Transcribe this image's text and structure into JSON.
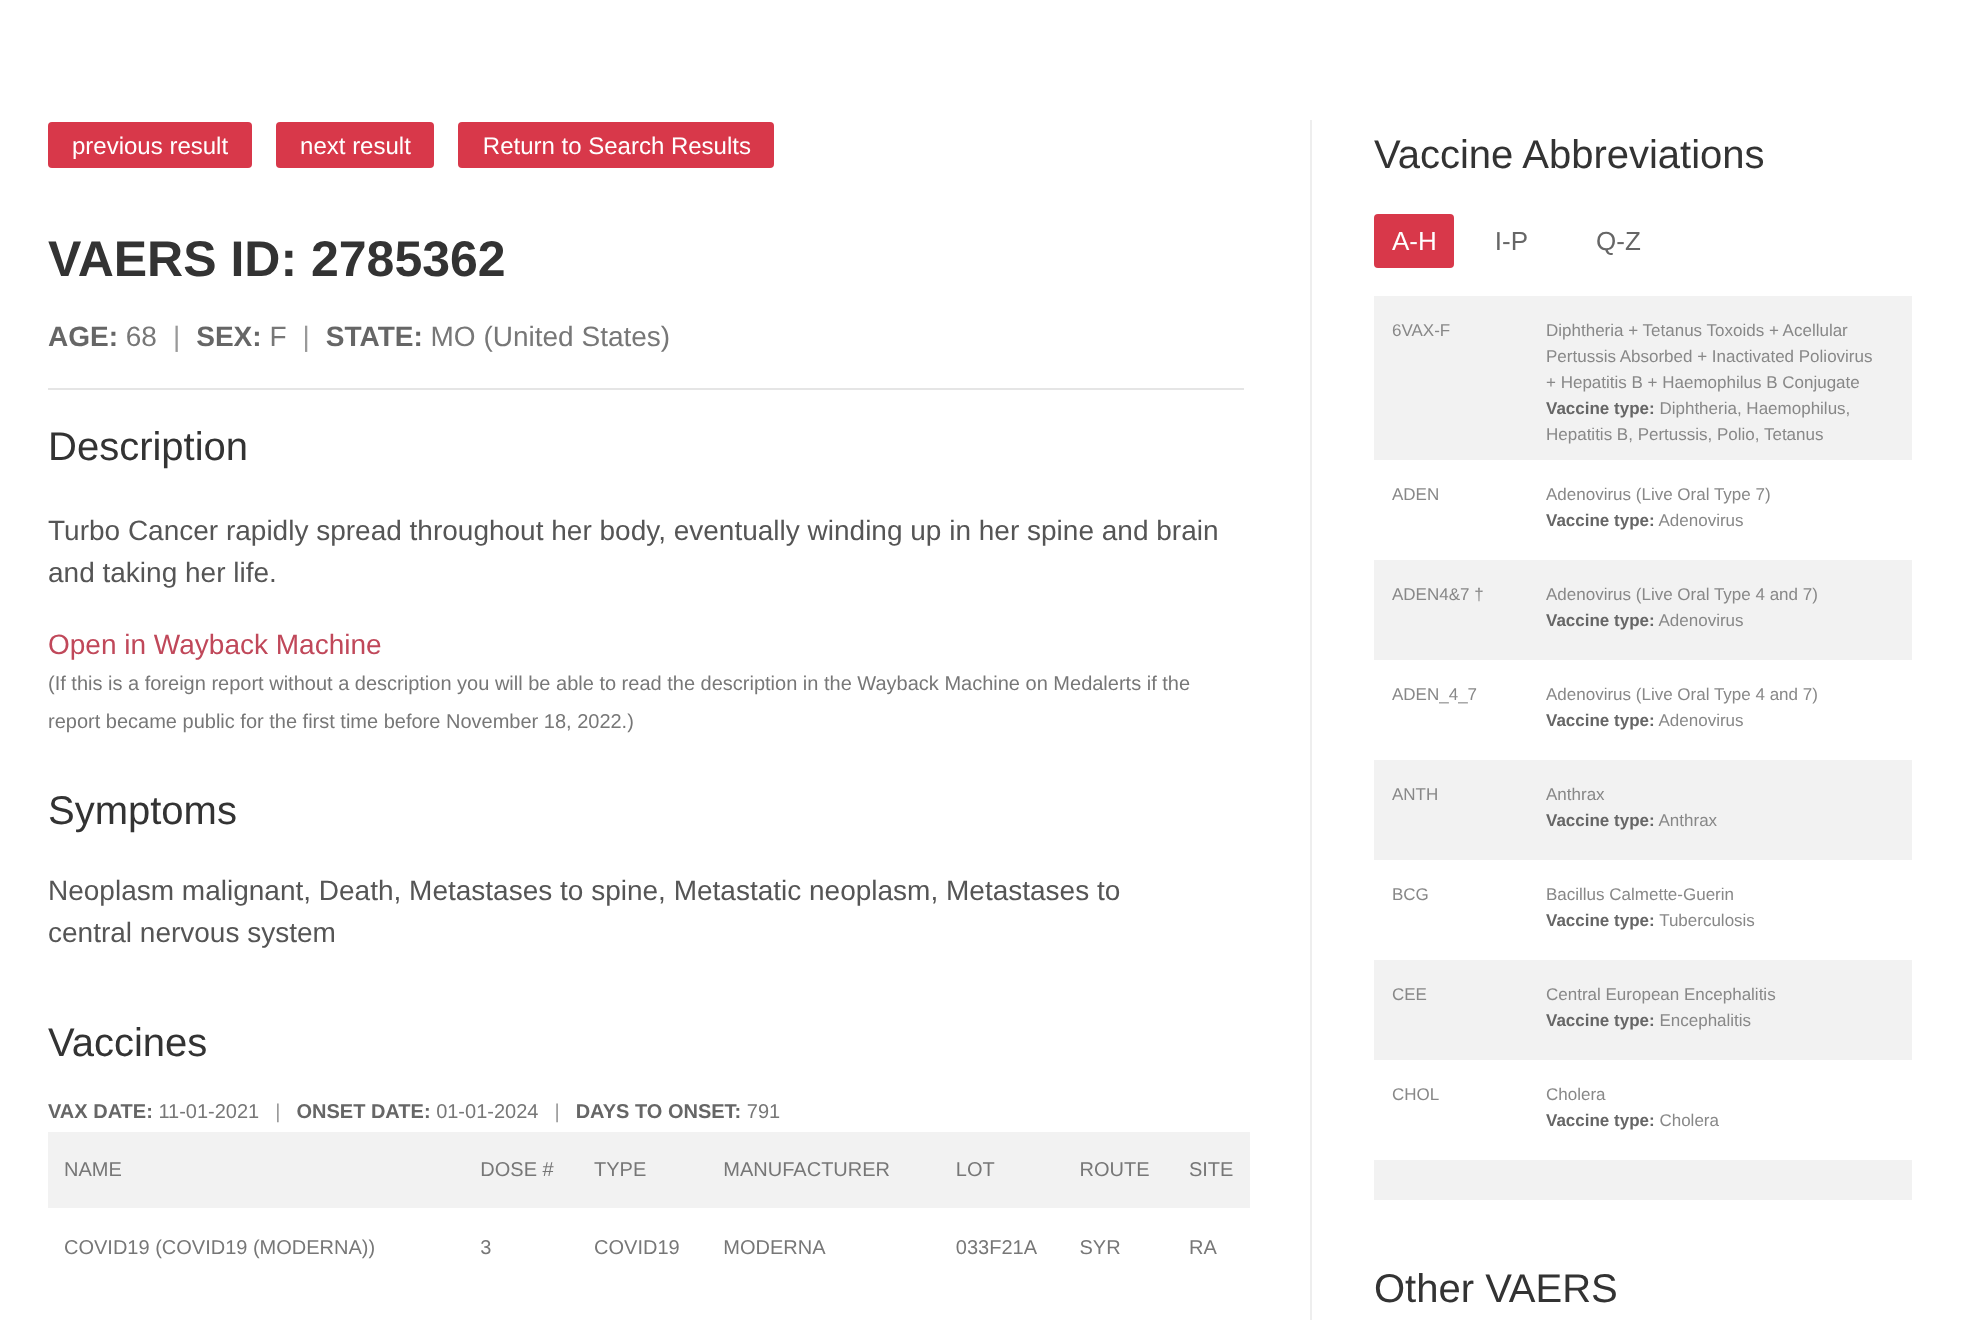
{
  "nav_buttons": [
    "previous result",
    "next result",
    "Return to Search Results"
  ],
  "report": {
    "title": "VAERS ID: 2785362",
    "meta": [
      {
        "label": "AGE:",
        "value": "68"
      },
      {
        "separator": "|",
        "label": "SEX:",
        "value": "F"
      },
      {
        "separator": "|",
        "label": "STATE:",
        "value": "MO (United States)"
      }
    ]
  },
  "description": {
    "heading": "Description",
    "text": "Turbo Cancer rapidly spread throughout her body, eventually winding up in her spine and brain and taking her life.",
    "link": "Open in Wayback Machine",
    "note": "(If this is a foreign report without a description you will be able to read the description in the Wayback Machine on Medalerts if the report became public for the first time before November 18, 2022.)"
  },
  "symptoms": {
    "heading": "Symptoms",
    "text": "Neoplasm malignant, Death, Metastases to spine, Metastatic neoplasm, Metastases to central nervous system"
  },
  "vaccines": {
    "heading": "Vaccines",
    "meta": [
      {
        "label": "VAX DATE:",
        "value": "11-01-2021"
      },
      {
        "separator": "|",
        "label": "ONSET DATE:",
        "value": "01-01-2024"
      },
      {
        "separator": "|",
        "label": "DAYS TO ONSET:",
        "value": "791"
      }
    ],
    "table": {
      "columns": [
        "NAME",
        "DOSE #",
        "TYPE",
        "MANUFACTURER",
        "LOT",
        "ROUTE",
        "SITE"
      ],
      "rows": [
        [
          "COVID19 (COVID19 (MODERNA))",
          "3",
          "COVID19",
          "MODERNA",
          "033F21A",
          "SYR",
          "RA"
        ]
      ]
    }
  },
  "sidebar": {
    "heading": "Vaccine Abbreviations",
    "tabs": [
      {
        "label": "A-H",
        "selected": true
      },
      {
        "label": "I-P",
        "selected": false
      },
      {
        "label": "Q-Z",
        "selected": false
      }
    ],
    "abbreviations": [
      {
        "code": "6VAX-F",
        "name": "Diphtheria + Tetanus Toxoids + Acellular Pertussis Absorbed + Inactivated Poliovirus + Hepatitis B + Haemophilus B Conjugate",
        "type_label": "Vaccine type:",
        "type": "Diphtheria, Haemophilus, Hepatitis B, Pertussis, Polio, Tetanus"
      },
      {
        "code": "ADEN",
        "name": "Adenovirus (Live Oral Type 7)",
        "type_label": "Vaccine type:",
        "type": "Adenovirus"
      },
      {
        "code": "ADEN4&7 †",
        "name": "Adenovirus (Live Oral Type 4 and 7)",
        "type_label": "Vaccine type:",
        "type": "Adenovirus"
      },
      {
        "code": "ADEN_4_7",
        "name": "Adenovirus (Live Oral Type 4 and 7)",
        "type_label": "Vaccine type:",
        "type": "Adenovirus"
      },
      {
        "code": "ANTH",
        "name": "Anthrax",
        "type_label": "Vaccine type:",
        "type": "Anthrax"
      },
      {
        "code": "BCG",
        "name": "Bacillus Calmette-Guerin",
        "type_label": "Vaccine type:",
        "type": "Tuberculosis"
      },
      {
        "code": "CEE",
        "name": "Central European Encephalitis",
        "type_label": "Vaccine type:",
        "type": "Encephalitis"
      },
      {
        "code": "CHOL",
        "name": "Cholera",
        "type_label": "Vaccine type:",
        "type": "Cholera"
      }
    ],
    "next_heading": "Other VAERS"
  }
}
